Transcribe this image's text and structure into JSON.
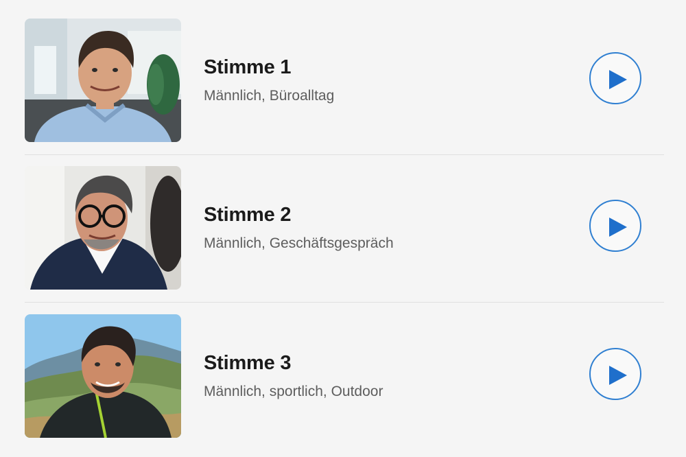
{
  "voices": [
    {
      "title": "Stimme 1",
      "subtitle": "Männlich, Büroalltag",
      "photo": "man-office-portrait",
      "play_icon": "play-icon"
    },
    {
      "title": "Stimme 2",
      "subtitle": "Männlich, Geschäftsgespräch",
      "photo": "man-glasses-business-portrait",
      "play_icon": "play-icon"
    },
    {
      "title": "Stimme 3",
      "subtitle": "Männlich, sportlich, Outdoor",
      "photo": "man-outdoor-mountain-portrait",
      "play_icon": "play-icon"
    }
  ],
  "colors": {
    "accent": "#1f6fcb",
    "background": "#f5f5f5",
    "title": "#1b1b1b",
    "subtitle": "#5d5d5d"
  }
}
